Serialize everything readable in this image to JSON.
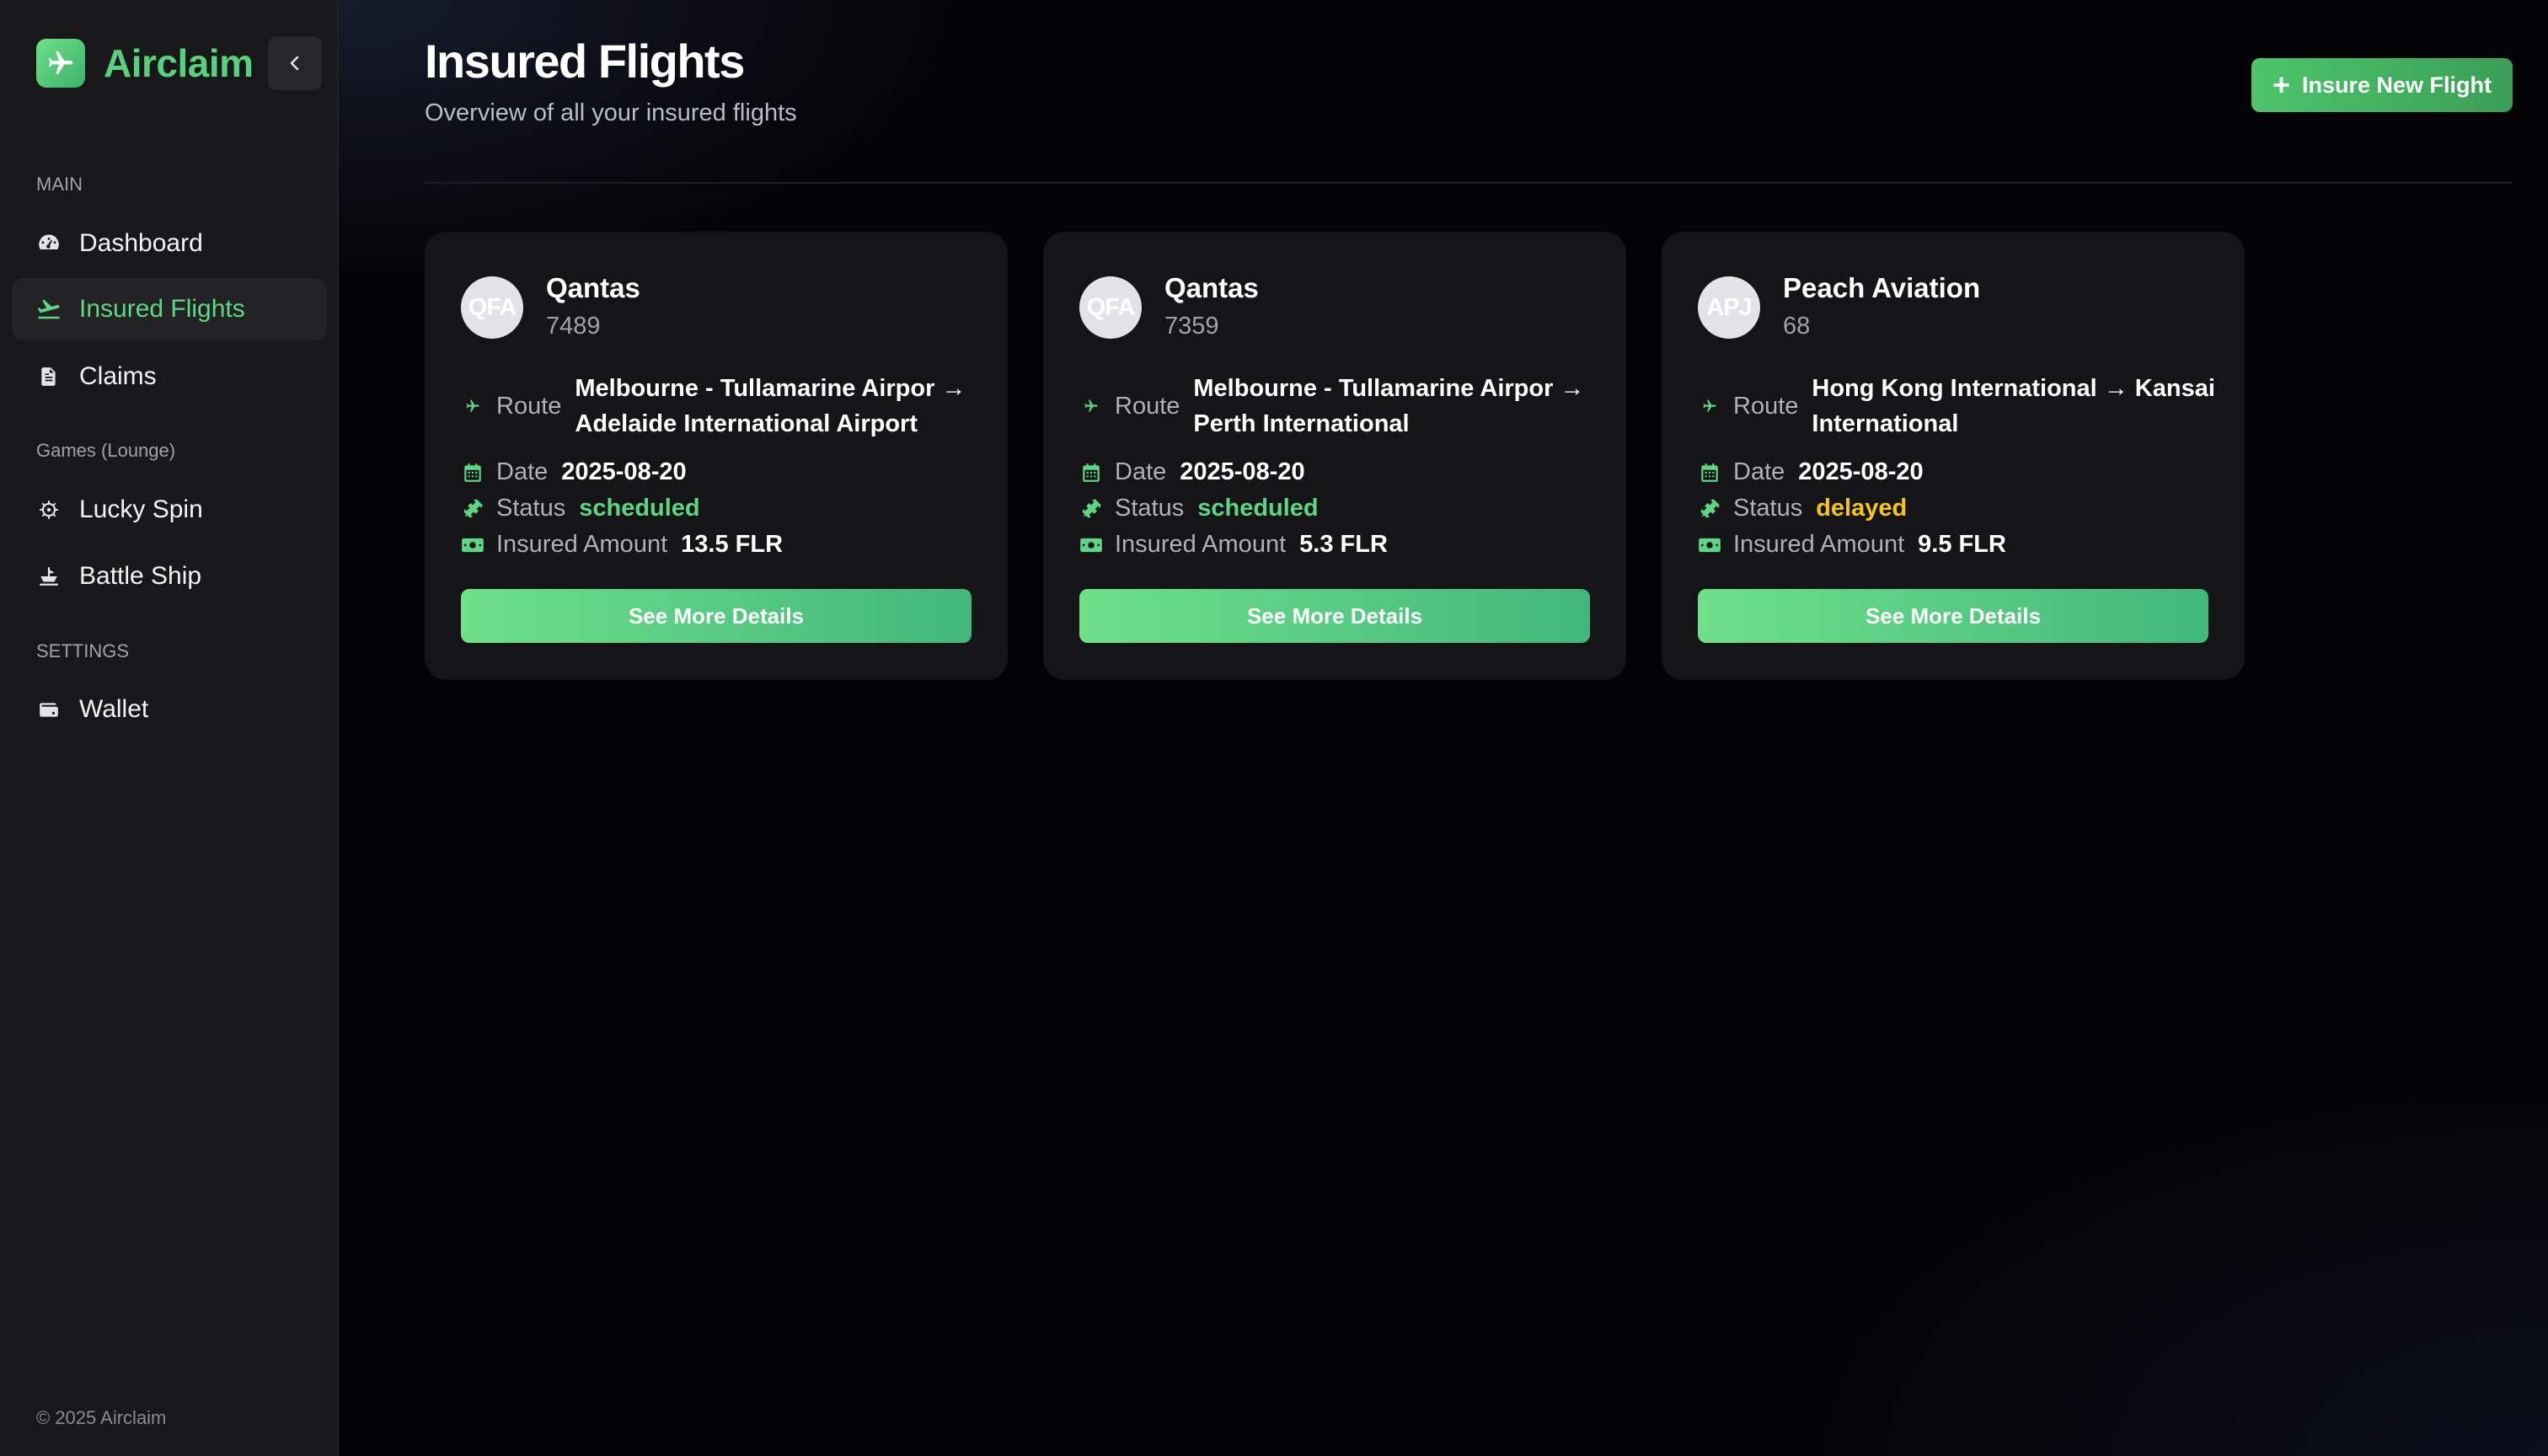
{
  "app": {
    "name": "Airclaim"
  },
  "sidebar": {
    "sections": [
      {
        "label": "MAIN"
      },
      {
        "label": "Games (Lounge)"
      },
      {
        "label": "SETTINGS"
      }
    ],
    "items": [
      {
        "label": "Dashboard",
        "icon": "gauge-icon",
        "active": false
      },
      {
        "label": "Insured Flights",
        "icon": "plane-departure-icon",
        "active": true
      },
      {
        "label": "Claims",
        "icon": "document-icon",
        "active": false
      },
      {
        "label": "Lucky Spin",
        "icon": "wheel-icon",
        "active": false
      },
      {
        "label": "Battle Ship",
        "icon": "ship-icon",
        "active": false
      },
      {
        "label": "Wallet",
        "icon": "wallet-icon",
        "active": false
      }
    ],
    "footer": "© 2025 Airclaim"
  },
  "header": {
    "title": "Insured Flights",
    "subtitle": "Overview of all your insured flights",
    "insure_button": "Insure New Flight"
  },
  "labels": {
    "route": "Route",
    "date": "Date",
    "status": "Status",
    "amount": "Insured Amount",
    "details_button": "See More Details"
  },
  "flights": [
    {
      "code": "QFA",
      "airline": "Qantas",
      "number": "7489",
      "route": "Melbourne - Tullamarine Airpor → Adelaide International Airport",
      "date": "2025-08-20",
      "status": "scheduled",
      "amount": "13.5 FLR"
    },
    {
      "code": "QFA",
      "airline": "Qantas",
      "number": "7359",
      "route": "Melbourne - Tullamarine Airpor → Perth International",
      "date": "2025-08-20",
      "status": "scheduled",
      "amount": "5.3 FLR"
    },
    {
      "code": "APJ",
      "airline": "Peach Aviation",
      "number": "68",
      "route": "Hong Kong International → Kansai International",
      "date": "2025-08-20",
      "status": "delayed",
      "amount": "9.5 FLR"
    }
  ],
  "colors": {
    "accent": "#58d17c",
    "scheduled": "#5cd683",
    "delayed": "#f5c518"
  }
}
